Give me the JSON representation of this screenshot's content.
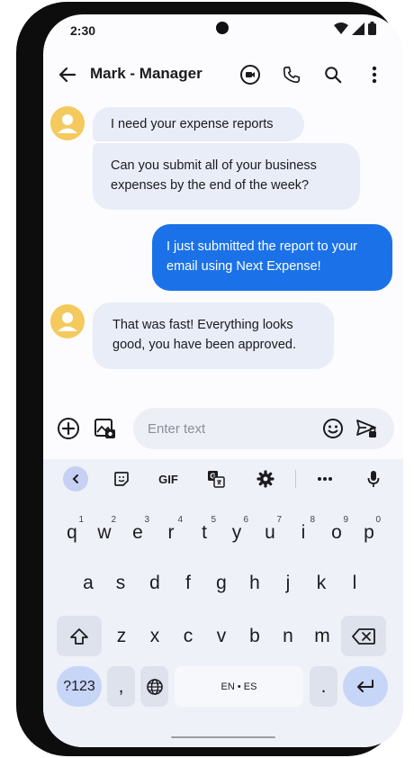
{
  "status_bar": {
    "time": "2:30"
  },
  "header": {
    "title": "Mark - Manager"
  },
  "messages": [
    {
      "text": "I need your expense reports"
    },
    {
      "text": "Can you submit all of your business expenses by the end of the week?"
    },
    {
      "text": "I just submitted the report to your email using Next Expense!"
    },
    {
      "text": "That was fast! Everything looks good, you have been approved."
    }
  ],
  "composer": {
    "placeholder": "Enter text"
  },
  "keyboard": {
    "toolbar": {
      "gif_label": "GIF"
    },
    "row1": [
      {
        "key": "q",
        "hint": "1"
      },
      {
        "key": "w",
        "hint": "2"
      },
      {
        "key": "e",
        "hint": "3"
      },
      {
        "key": "r",
        "hint": "4"
      },
      {
        "key": "t",
        "hint": "5"
      },
      {
        "key": "y",
        "hint": "6"
      },
      {
        "key": "u",
        "hint": "7"
      },
      {
        "key": "i",
        "hint": "8"
      },
      {
        "key": "o",
        "hint": "9"
      },
      {
        "key": "p",
        "hint": "0"
      }
    ],
    "row2": [
      "a",
      "s",
      "d",
      "f",
      "g",
      "h",
      "j",
      "k",
      "l"
    ],
    "row3": [
      "z",
      "x",
      "c",
      "v",
      "b",
      "n",
      "m"
    ],
    "symbols_label": "?123",
    "comma_label": ",",
    "space_label": "EN • ES",
    "period_label": "."
  },
  "colors": {
    "accent": "#1b72e8",
    "incoming_bubble": "#e8edf8",
    "avatar": "#f4c95d"
  }
}
